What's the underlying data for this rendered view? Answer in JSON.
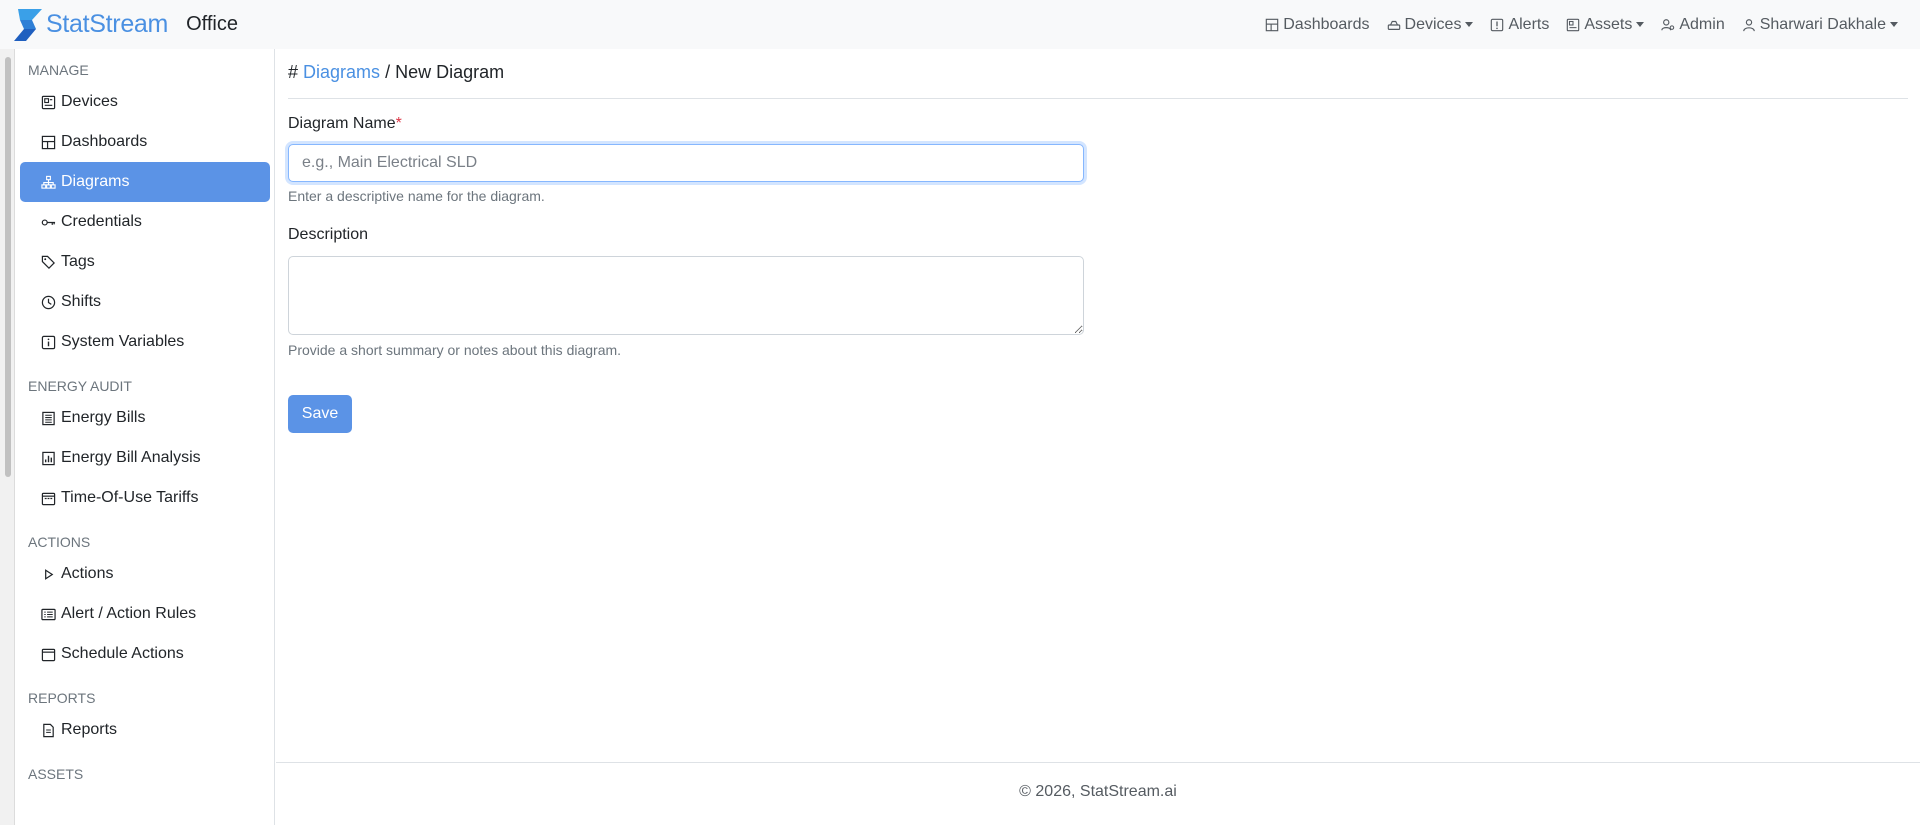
{
  "app": {
    "brand_name": "StatStream",
    "workspace": "Office"
  },
  "topnav": {
    "dashboards": "Dashboards",
    "devices": "Devices",
    "alerts": "Alerts",
    "assets": "Assets",
    "admin": "Admin",
    "user": "Sharwari Dakhale"
  },
  "sidebar": {
    "manage": {
      "heading": "MANAGE",
      "items": [
        {
          "label": "Devices",
          "icon": "device-icon"
        },
        {
          "label": "Dashboards",
          "icon": "dashboard-icon"
        },
        {
          "label": "Diagrams",
          "icon": "diagram-icon",
          "active": true
        },
        {
          "label": "Credentials",
          "icon": "key-icon"
        },
        {
          "label": "Tags",
          "icon": "tags-icon"
        },
        {
          "label": "Shifts",
          "icon": "clock-icon"
        },
        {
          "label": "System Variables",
          "icon": "info-icon"
        }
      ]
    },
    "energy": {
      "heading": "ENERGY AUDIT",
      "items": [
        {
          "label": "Energy Bills",
          "icon": "bill-icon"
        },
        {
          "label": "Energy Bill Analysis",
          "icon": "analysis-icon"
        },
        {
          "label": "Time-Of-Use Tariffs",
          "icon": "calendar-icon"
        }
      ]
    },
    "actions": {
      "heading": "ACTIONS",
      "items": [
        {
          "label": "Actions",
          "icon": "play-icon"
        },
        {
          "label": "Alert / Action Rules",
          "icon": "rules-icon"
        },
        {
          "label": "Schedule Actions",
          "icon": "calendar-icon"
        }
      ]
    },
    "reports": {
      "heading": "REPORTS",
      "items": [
        {
          "label": "Reports",
          "icon": "report-icon"
        }
      ]
    },
    "assets": {
      "heading": "ASSETS"
    }
  },
  "breadcrumb": {
    "hash": "#",
    "parent": "Diagrams",
    "separator": "/",
    "current": "New Diagram"
  },
  "form": {
    "name_label": "Diagram Name",
    "required_mark": "*",
    "name_value": "",
    "name_placeholder": "e.g., Main Electrical SLD",
    "name_help": "Enter a descriptive name for the diagram.",
    "description_label": "Description",
    "description_value": "",
    "description_help": "Provide a short summary or notes about this diagram.",
    "save_label": "Save"
  },
  "footer": {
    "text": "© 2026, StatStream.ai"
  },
  "colors": {
    "accent": "#4a90e2",
    "active_bg": "#5b93e6",
    "required": "#dc3545"
  }
}
